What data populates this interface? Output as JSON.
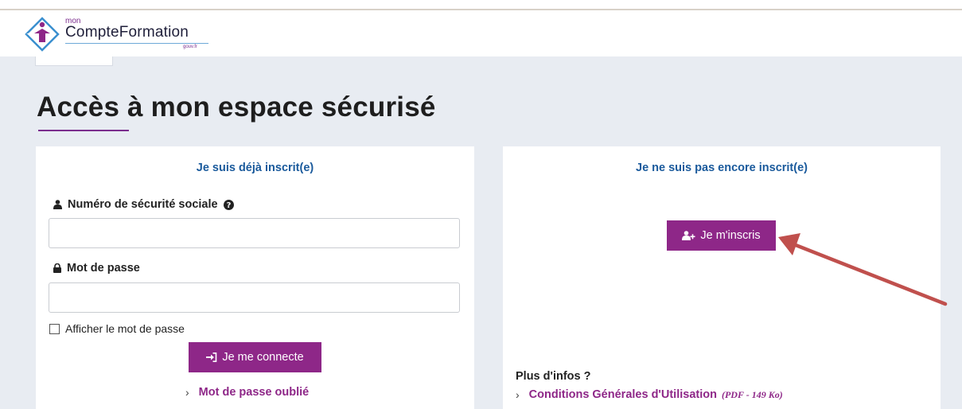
{
  "header": {
    "logo_small": "mon",
    "logo_main": "CompteFormation",
    "logo_gouv": "gouv.fr"
  },
  "page": {
    "title": "Accès à mon espace sécurisé"
  },
  "login": {
    "heading": "Je suis déjà inscrit(e)",
    "ssn_label": "Numéro de sécurité sociale",
    "ssn_value": "",
    "password_label": "Mot de passe",
    "password_value": "",
    "show_password_label": "Afficher le mot de passe",
    "show_password_checked": false,
    "connect_button": "Je me connecte",
    "forgot_link": "Mot de passe oublié"
  },
  "register": {
    "heading": "Je ne suis pas encore inscrit(e)",
    "signup_button": "Je m'inscris",
    "info_title": "Plus d'infos ?",
    "cgu_link": "Conditions Générales d'Utilisation",
    "cgu_meta": "(PDF - 149 Ko)"
  },
  "icons": {
    "logo": "logo-icon",
    "user": "user-icon",
    "help": "question-circle-icon",
    "lock": "lock-icon",
    "login": "sign-in-icon",
    "add_user": "user-plus-icon",
    "chevron": "chevron-right-icon",
    "annotation_arrow": "arrow-icon"
  },
  "colors": {
    "brand_purple": "#8e2788",
    "heading_blue": "#1a5a9c",
    "background": "#e8ecf2",
    "annotation_arrow": "#c0504d"
  }
}
